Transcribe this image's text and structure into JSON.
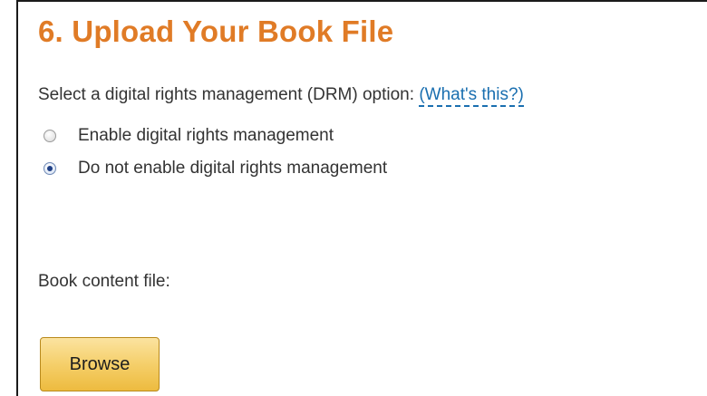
{
  "section": {
    "title": "6. Upload Your Book File"
  },
  "drm": {
    "prompt": "Select a digital rights management (DRM) option:",
    "help_link": "(What's this?)",
    "options": [
      {
        "label": "Enable digital rights management",
        "selected": false
      },
      {
        "label": "Do not enable digital rights management",
        "selected": true
      }
    ]
  },
  "file": {
    "label": "Book content file:",
    "browse_label": "Browse"
  },
  "colors": {
    "title": "#e07b26",
    "link": "#1a6fb0",
    "button": "#f5cf6a"
  }
}
